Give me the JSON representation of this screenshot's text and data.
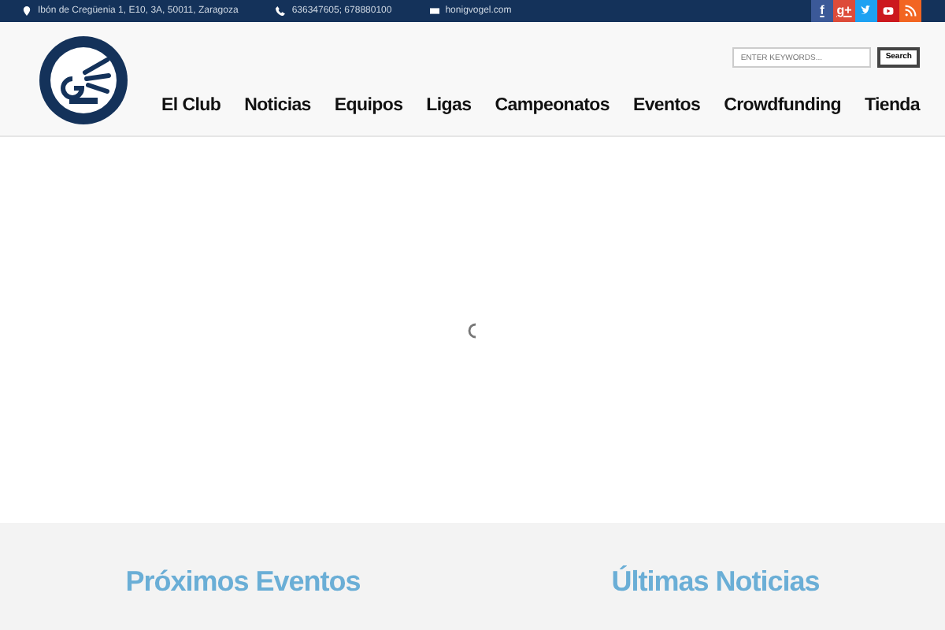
{
  "topbar": {
    "address": "Ibón de Cregüenia 1, E10, 3A, 50011, Zaragoza",
    "phone": "636347605; 678880100",
    "email": "honigvogel.com",
    "social": [
      {
        "kind": "facebook",
        "label": "f",
        "color": "#3b5998"
      },
      {
        "kind": "googleplus",
        "label": "g+",
        "color": "#dd4b39"
      },
      {
        "kind": "twitter",
        "color": "#1da1f2"
      },
      {
        "kind": "youtube",
        "color": "#cc181e"
      },
      {
        "kind": "rss",
        "color": "#f26522"
      }
    ]
  },
  "search": {
    "placeholder": "ENTER KEYWORDS...",
    "button": "Search"
  },
  "nav": [
    "El Club",
    "Noticias",
    "Equipos",
    "Ligas",
    "Campeonatos",
    "Eventos",
    "Crowdfunding",
    "Tienda"
  ],
  "sections": [
    "Próximos Eventos",
    "Últimas Noticias"
  ]
}
